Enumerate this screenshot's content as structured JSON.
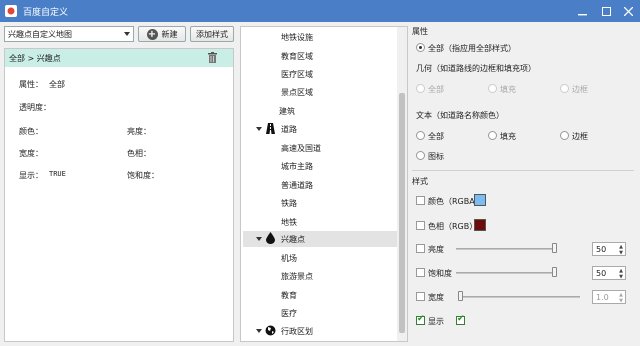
{
  "window": {
    "title": "百度自定义"
  },
  "left": {
    "combo_value": "兴趣点自定义地图",
    "new_button": "新建",
    "add_style_button": "添加样式",
    "selected_row": "全部 > 兴趣点",
    "props": {
      "attr_label": "属性：",
      "attr_value": "全部",
      "opacity_label": "透明度：",
      "color_label": "颜色：",
      "lightness_label": "亮度：",
      "width_label": "宽度：",
      "hue_label": "色相：",
      "visible_label": "显示：",
      "visible_value": "TRUE",
      "saturation_label": "饱和度："
    }
  },
  "tree": {
    "items": [
      "地铁设施",
      "教育区域",
      "医疗区域",
      "景点区域",
      "建筑",
      "道路",
      "高速及国道",
      "城市主路",
      "普通道路",
      "铁路",
      "地铁",
      "兴趣点",
      "机场",
      "旅游景点",
      "教育",
      "医疗",
      "行政区划"
    ]
  },
  "right": {
    "attr_heading": "属性",
    "attr_all": "全部（指应用全部样式）",
    "geom_heading": "几何（如道路线的边框和填充项）",
    "geom_all": "全部",
    "geom_fill": "填充",
    "geom_border": "边框",
    "text_heading": "文本（如道路名称颜色）",
    "text_all": "全部",
    "text_fill": "填充",
    "text_border": "边框",
    "text_icon": "图标",
    "style_heading": "样式",
    "color_label": "颜色（RGBA）",
    "hue_label": "色相（RGB）",
    "lightness_label": "亮度",
    "lightness_value": "50",
    "saturation_label": "饱和度",
    "saturation_value": "50",
    "width_label": "宽度",
    "width_value": "1.0",
    "visible_label": "显示",
    "color_swatch": "#7bbcf3",
    "hue_swatch": "#6e0a0a"
  }
}
